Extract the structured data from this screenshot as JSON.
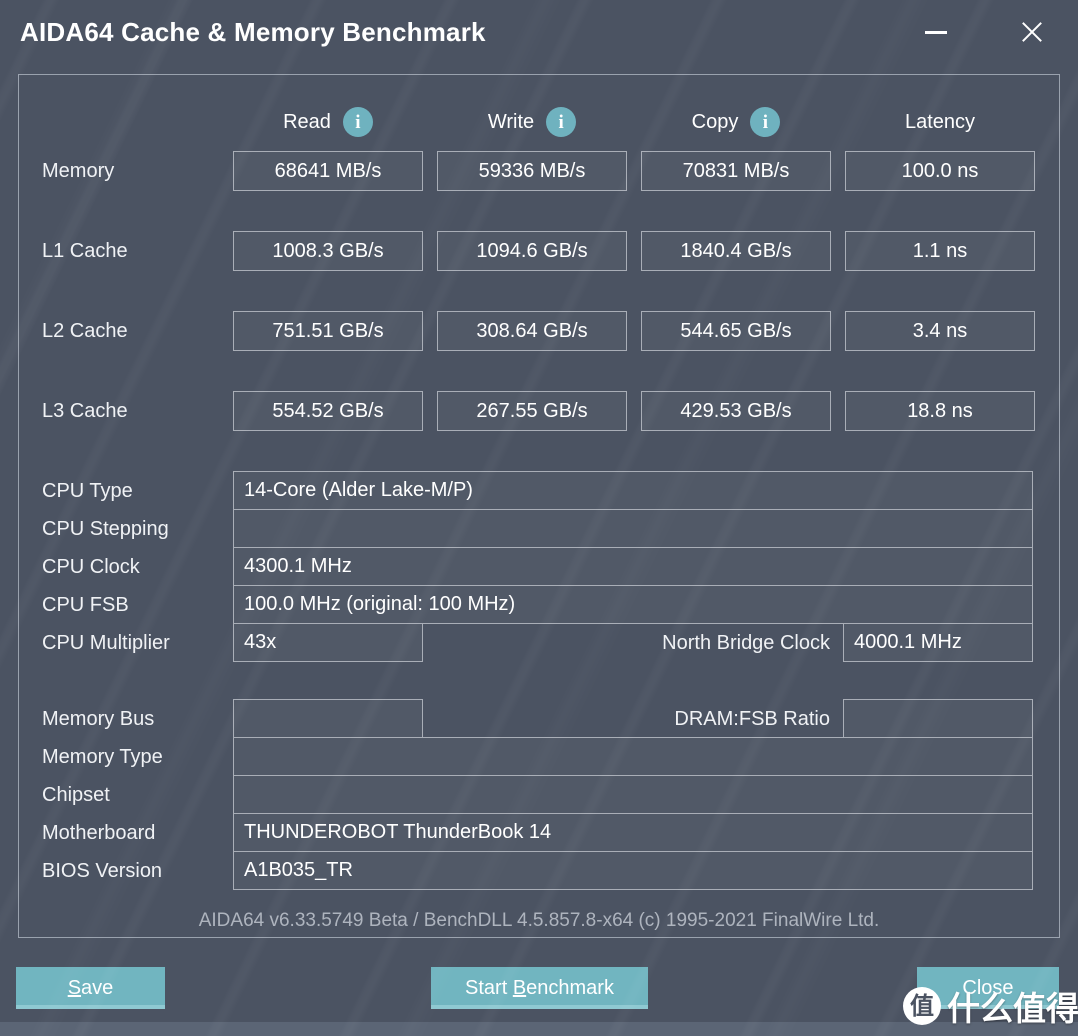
{
  "window": {
    "title": "AIDA64 Cache & Memory Benchmark",
    "minimize_icon": "minimize-icon",
    "close_icon": "close-icon"
  },
  "columns": [
    {
      "label": "Read",
      "info_icon": "info-icon"
    },
    {
      "label": "Write",
      "info_icon": "info-icon"
    },
    {
      "label": "Copy",
      "info_icon": "info-icon"
    },
    {
      "label": "Latency",
      "info_icon": null
    }
  ],
  "benchmark_rows": [
    {
      "label": "Memory",
      "read": "68641 MB/s",
      "write": "59336 MB/s",
      "copy": "70831 MB/s",
      "latency": "100.0 ns"
    },
    {
      "label": "L1 Cache",
      "read": "1008.3 GB/s",
      "write": "1094.6 GB/s",
      "copy": "1840.4 GB/s",
      "latency": "1.1 ns"
    },
    {
      "label": "L2 Cache",
      "read": "751.51 GB/s",
      "write": "308.64 GB/s",
      "copy": "544.65 GB/s",
      "latency": "3.4 ns"
    },
    {
      "label": "L3 Cache",
      "read": "554.52 GB/s",
      "write": "267.55 GB/s",
      "copy": "429.53 GB/s",
      "latency": "18.8 ns"
    }
  ],
  "cpu_info": [
    {
      "label": "CPU Type",
      "value": "14-Core   (Alder Lake-M/P)"
    },
    {
      "label": "CPU Stepping",
      "value": ""
    },
    {
      "label": "CPU Clock",
      "value": "4300.1 MHz"
    },
    {
      "label": "CPU FSB",
      "value": "100.0 MHz  (original: 100 MHz)"
    }
  ],
  "cpu_multiplier": {
    "label": "CPU Multiplier",
    "value": "43x",
    "side_label": "North Bridge Clock",
    "side_value": "4000.1 MHz"
  },
  "memory_bus": {
    "label": "Memory Bus",
    "value": "",
    "side_label": "DRAM:FSB Ratio",
    "side_value": ""
  },
  "system_info": [
    {
      "label": "Memory Type",
      "value": ""
    },
    {
      "label": "Chipset",
      "value": ""
    },
    {
      "label": "Motherboard",
      "value": "THUNDEROBOT ThunderBook 14"
    },
    {
      "label": "BIOS Version",
      "value": "A1B035_TR"
    }
  ],
  "version_text": "AIDA64 v6.33.5749 Beta / BenchDLL 4.5.857.8-x64  (c) 1995-2021 FinalWire Ltd.",
  "buttons": {
    "save": {
      "pre": "",
      "accel": "S",
      "post": "ave"
    },
    "start": {
      "pre": "Start ",
      "accel": "B",
      "post": "enchmark"
    },
    "close": {
      "pre": "",
      "accel": "",
      "post": "Close"
    }
  },
  "watermark": {
    "logo_char": "值",
    "text": "什么值得买"
  },
  "colors": {
    "background": "#4b5362",
    "accent_teal": "#71b5c0",
    "info_icon": "#6fb2bf",
    "border": "#a9aeb7",
    "text": "#ffffff",
    "muted_text": "#aeb4be"
  }
}
